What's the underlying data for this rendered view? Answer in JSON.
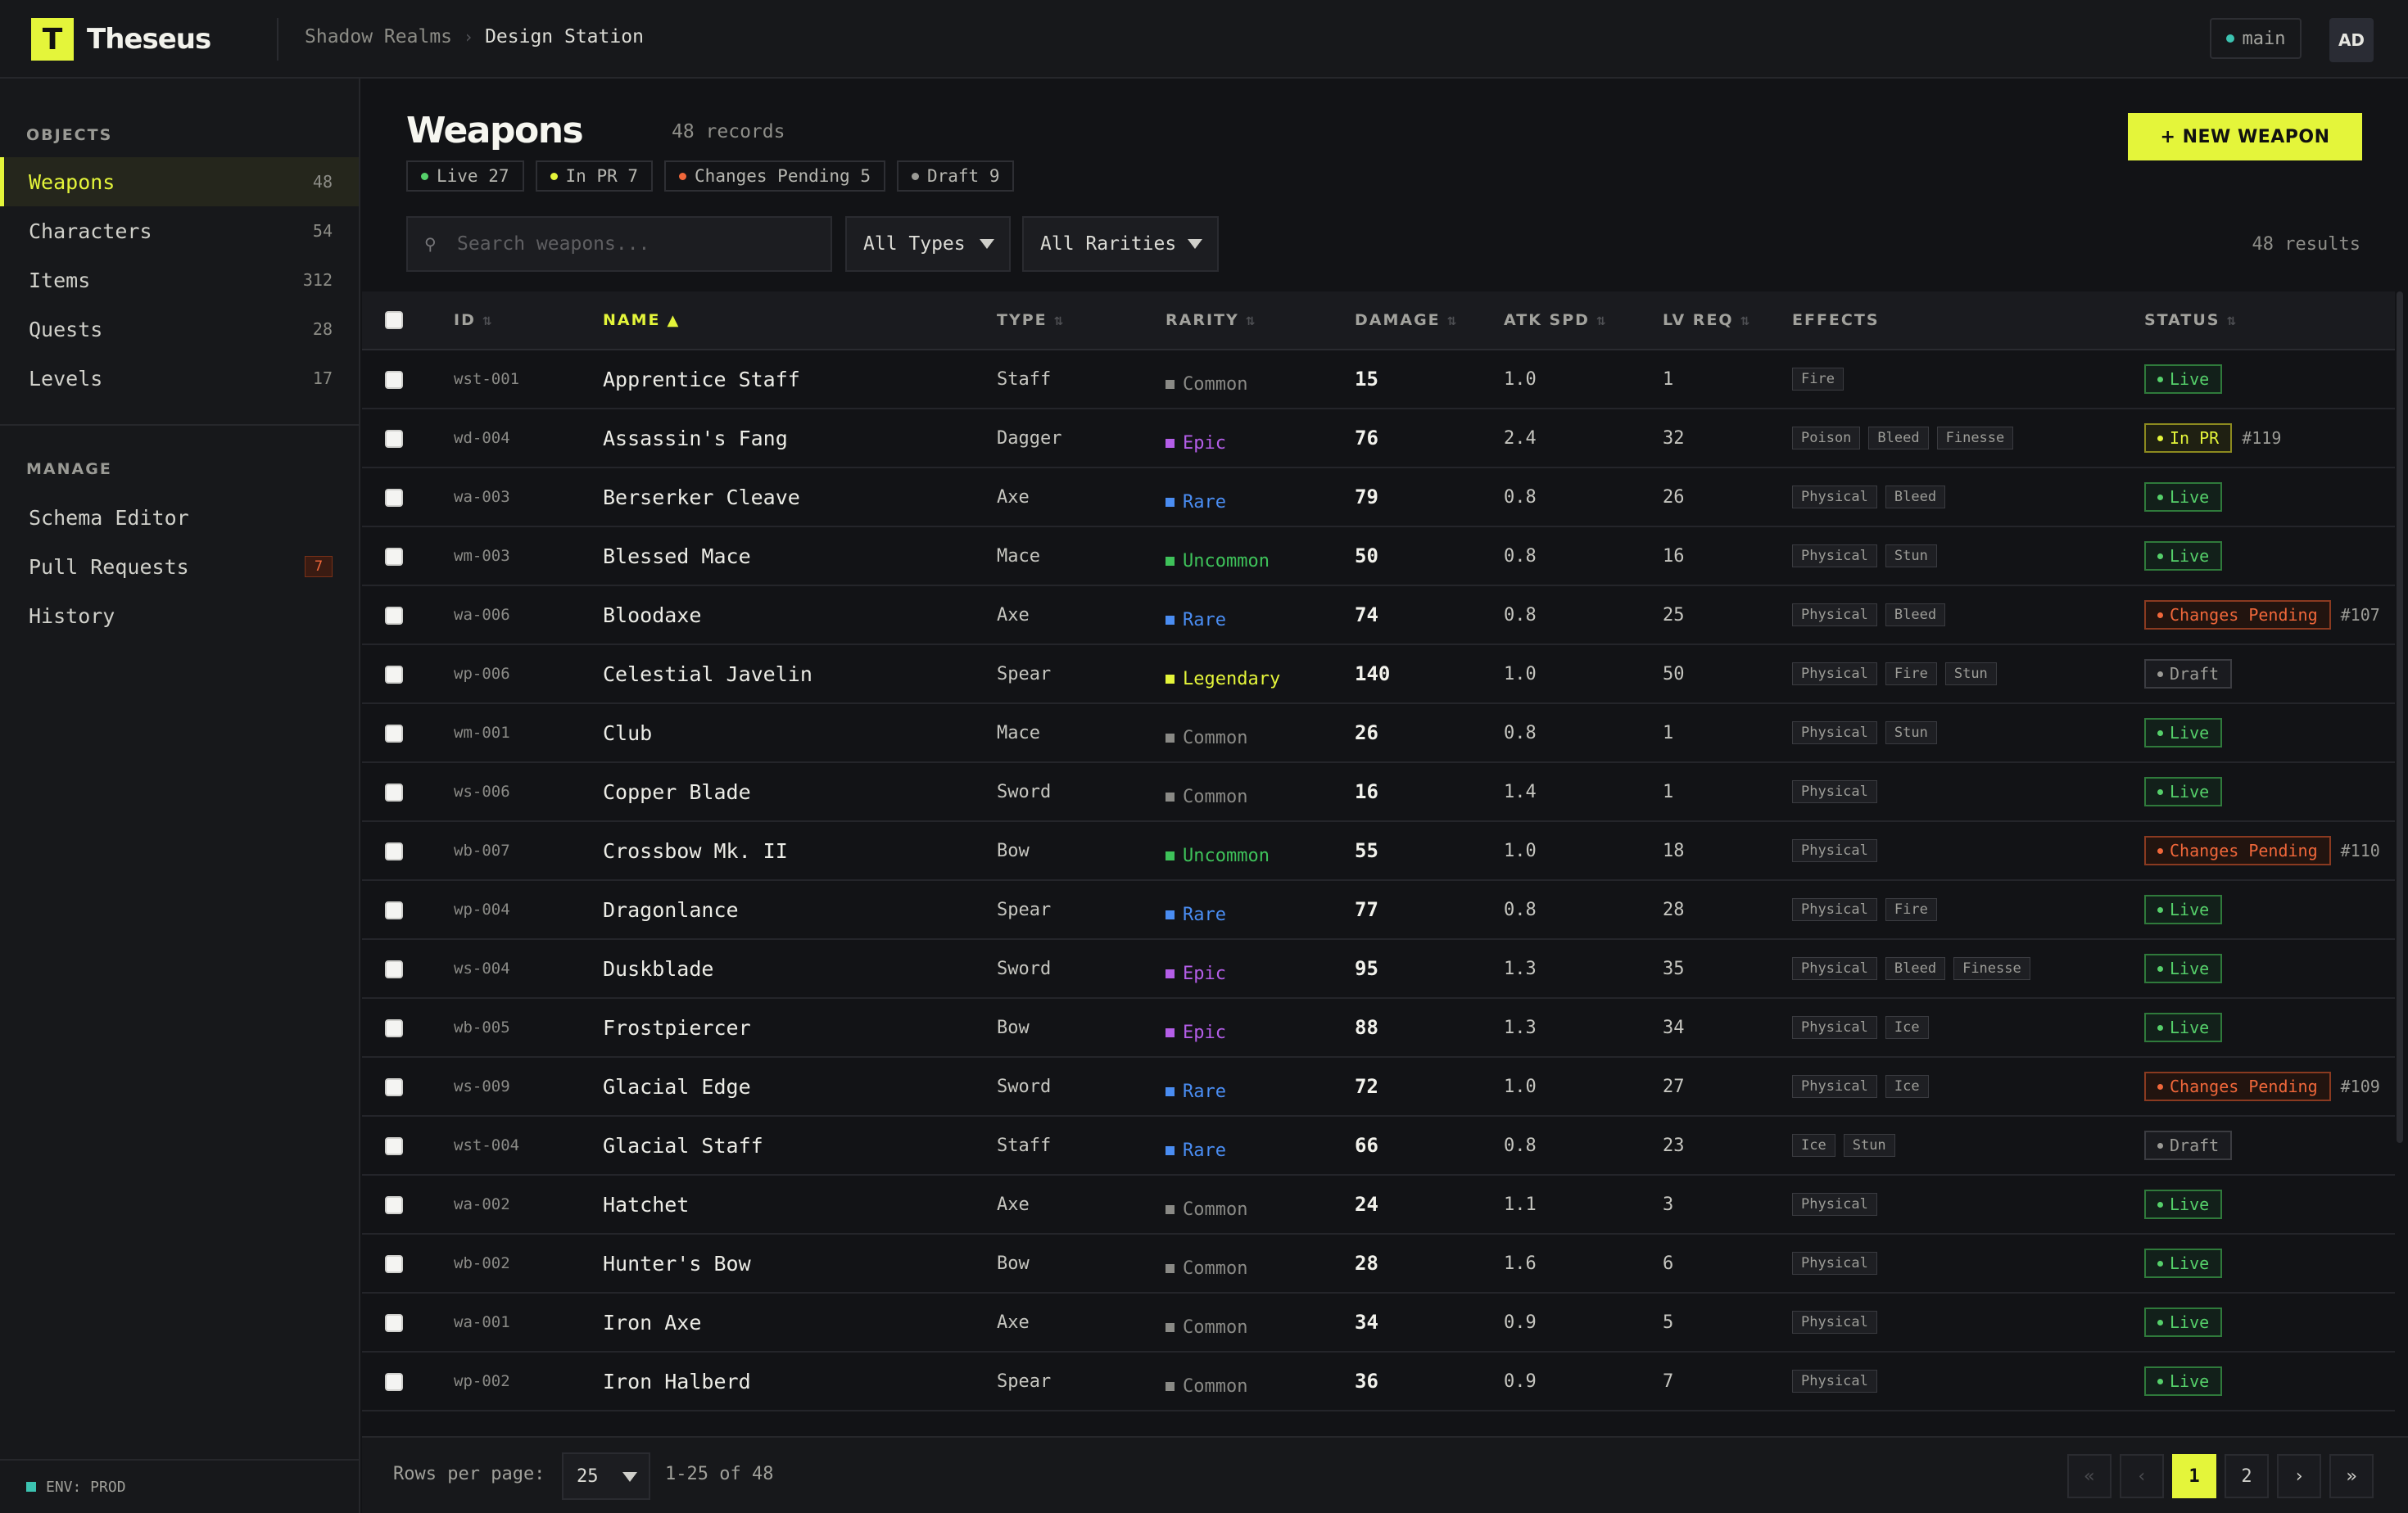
{
  "app": {
    "logo_letter": "T",
    "name": "Theseus"
  },
  "breadcrumb": [
    "Shadow Realms",
    "Design Station"
  ],
  "branch": {
    "name": "main",
    "icon": "branch-dot-icon"
  },
  "user": {
    "initials": "AD"
  },
  "sidebar": {
    "objects_heading": "OBJECTS",
    "objects": [
      {
        "label": "Weapons",
        "count": "48",
        "active": true
      },
      {
        "label": "Characters",
        "count": "54"
      },
      {
        "label": "Items",
        "count": "312"
      },
      {
        "label": "Quests",
        "count": "28"
      },
      {
        "label": "Levels",
        "count": "17"
      }
    ],
    "manage_heading": "MANAGE",
    "manage": [
      {
        "label": "Schema Editor"
      },
      {
        "label": "Pull Requests",
        "badge": "7"
      },
      {
        "label": "History"
      }
    ],
    "env": "ENV: PROD"
  },
  "header": {
    "title": "Weapons",
    "records": "48 records",
    "status_chips": [
      {
        "label": "Live 27",
        "color": "#55d06a"
      },
      {
        "label": "In PR 7",
        "color": "#e4f53a"
      },
      {
        "label": "Changes Pending 5",
        "color": "#f0673a"
      },
      {
        "label": "Draft 9",
        "color": "#9b9b96"
      }
    ],
    "new_button": "+ NEW WEAPON"
  },
  "filters": {
    "search_icon": "search-icon",
    "search_placeholder": "Search weapons...",
    "type_select": "All Types",
    "rarity_select": "All Rarities",
    "results": "48 results"
  },
  "columns": [
    "ID",
    "NAME",
    "TYPE",
    "RARITY",
    "DAMAGE",
    "ATK SPD",
    "LV REQ",
    "EFFECTS",
    "STATUS"
  ],
  "sort": {
    "column": "NAME",
    "direction": "asc"
  },
  "rarity_colors": {
    "Common": "#8a8a86",
    "Uncommon": "#3ec25a",
    "Rare": "#4a8df2",
    "Epic": "#b45ee8",
    "Legendary": "#e4f53a"
  },
  "rows": [
    {
      "id": "wst-001",
      "name": "Apprentice Staff",
      "type": "Staff",
      "rarity": "Common",
      "damage": "15",
      "atk_spd": "1.0",
      "lv_req": "1",
      "effects": [
        "Fire"
      ],
      "status": "Live",
      "pr": ""
    },
    {
      "id": "wd-004",
      "name": "Assassin's Fang",
      "type": "Dagger",
      "rarity": "Epic",
      "damage": "76",
      "atk_spd": "2.4",
      "lv_req": "32",
      "effects": [
        "Poison",
        "Bleed",
        "Finesse"
      ],
      "status": "In PR",
      "pr": "#119"
    },
    {
      "id": "wa-003",
      "name": "Berserker Cleave",
      "type": "Axe",
      "rarity": "Rare",
      "damage": "79",
      "atk_spd": "0.8",
      "lv_req": "26",
      "effects": [
        "Physical",
        "Bleed"
      ],
      "status": "Live",
      "pr": ""
    },
    {
      "id": "wm-003",
      "name": "Blessed Mace",
      "type": "Mace",
      "rarity": "Uncommon",
      "damage": "50",
      "atk_spd": "0.8",
      "lv_req": "16",
      "effects": [
        "Physical",
        "Stun"
      ],
      "status": "Live",
      "pr": ""
    },
    {
      "id": "wa-006",
      "name": "Bloodaxe",
      "type": "Axe",
      "rarity": "Rare",
      "damage": "74",
      "atk_spd": "0.8",
      "lv_req": "25",
      "effects": [
        "Physical",
        "Bleed"
      ],
      "status": "Changes Pending",
      "pr": "#107"
    },
    {
      "id": "wp-006",
      "name": "Celestial Javelin",
      "type": "Spear",
      "rarity": "Legendary",
      "damage": "140",
      "atk_spd": "1.0",
      "lv_req": "50",
      "effects": [
        "Physical",
        "Fire",
        "Stun"
      ],
      "status": "Draft",
      "pr": ""
    },
    {
      "id": "wm-001",
      "name": "Club",
      "type": "Mace",
      "rarity": "Common",
      "damage": "26",
      "atk_spd": "0.8",
      "lv_req": "1",
      "effects": [
        "Physical",
        "Stun"
      ],
      "status": "Live",
      "pr": ""
    },
    {
      "id": "ws-006",
      "name": "Copper Blade",
      "type": "Sword",
      "rarity": "Common",
      "damage": "16",
      "atk_spd": "1.4",
      "lv_req": "1",
      "effects": [
        "Physical"
      ],
      "status": "Live",
      "pr": ""
    },
    {
      "id": "wb-007",
      "name": "Crossbow Mk. II",
      "type": "Bow",
      "rarity": "Uncommon",
      "damage": "55",
      "atk_spd": "1.0",
      "lv_req": "18",
      "effects": [
        "Physical"
      ],
      "status": "Changes Pending",
      "pr": "#110"
    },
    {
      "id": "wp-004",
      "name": "Dragonlance",
      "type": "Spear",
      "rarity": "Rare",
      "damage": "77",
      "atk_spd": "0.8",
      "lv_req": "28",
      "effects": [
        "Physical",
        "Fire"
      ],
      "status": "Live",
      "pr": ""
    },
    {
      "id": "ws-004",
      "name": "Duskblade",
      "type": "Sword",
      "rarity": "Epic",
      "damage": "95",
      "atk_spd": "1.3",
      "lv_req": "35",
      "effects": [
        "Physical",
        "Bleed",
        "Finesse"
      ],
      "status": "Live",
      "pr": ""
    },
    {
      "id": "wb-005",
      "name": "Frostpiercer",
      "type": "Bow",
      "rarity": "Epic",
      "damage": "88",
      "atk_spd": "1.3",
      "lv_req": "34",
      "effects": [
        "Physical",
        "Ice"
      ],
      "status": "Live",
      "pr": ""
    },
    {
      "id": "ws-009",
      "name": "Glacial Edge",
      "type": "Sword",
      "rarity": "Rare",
      "damage": "72",
      "atk_spd": "1.0",
      "lv_req": "27",
      "effects": [
        "Physical",
        "Ice"
      ],
      "status": "Changes Pending",
      "pr": "#109"
    },
    {
      "id": "wst-004",
      "name": "Glacial Staff",
      "type": "Staff",
      "rarity": "Rare",
      "damage": "66",
      "atk_spd": "0.8",
      "lv_req": "23",
      "effects": [
        "Ice",
        "Stun"
      ],
      "status": "Draft",
      "pr": ""
    },
    {
      "id": "wa-002",
      "name": "Hatchet",
      "type": "Axe",
      "rarity": "Common",
      "damage": "24",
      "atk_spd": "1.1",
      "lv_req": "3",
      "effects": [
        "Physical"
      ],
      "status": "Live",
      "pr": ""
    },
    {
      "id": "wb-002",
      "name": "Hunter's Bow",
      "type": "Bow",
      "rarity": "Common",
      "damage": "28",
      "atk_spd": "1.6",
      "lv_req": "6",
      "effects": [
        "Physical"
      ],
      "status": "Live",
      "pr": ""
    },
    {
      "id": "wa-001",
      "name": "Iron Axe",
      "type": "Axe",
      "rarity": "Common",
      "damage": "34",
      "atk_spd": "0.9",
      "lv_req": "5",
      "effects": [
        "Physical"
      ],
      "status": "Live",
      "pr": ""
    },
    {
      "id": "wp-002",
      "name": "Iron Halberd",
      "type": "Spear",
      "rarity": "Common",
      "damage": "36",
      "atk_spd": "0.9",
      "lv_req": "7",
      "effects": [
        "Physical"
      ],
      "status": "Live",
      "pr": ""
    }
  ],
  "footer": {
    "rows_per_page_label": "Rows per page:",
    "rows_per_page": "25",
    "range": "1-25 of 48",
    "pages": [
      "1",
      "2"
    ],
    "current_page": "1",
    "first": "«",
    "prev": "‹",
    "next": "›",
    "last": "»"
  }
}
